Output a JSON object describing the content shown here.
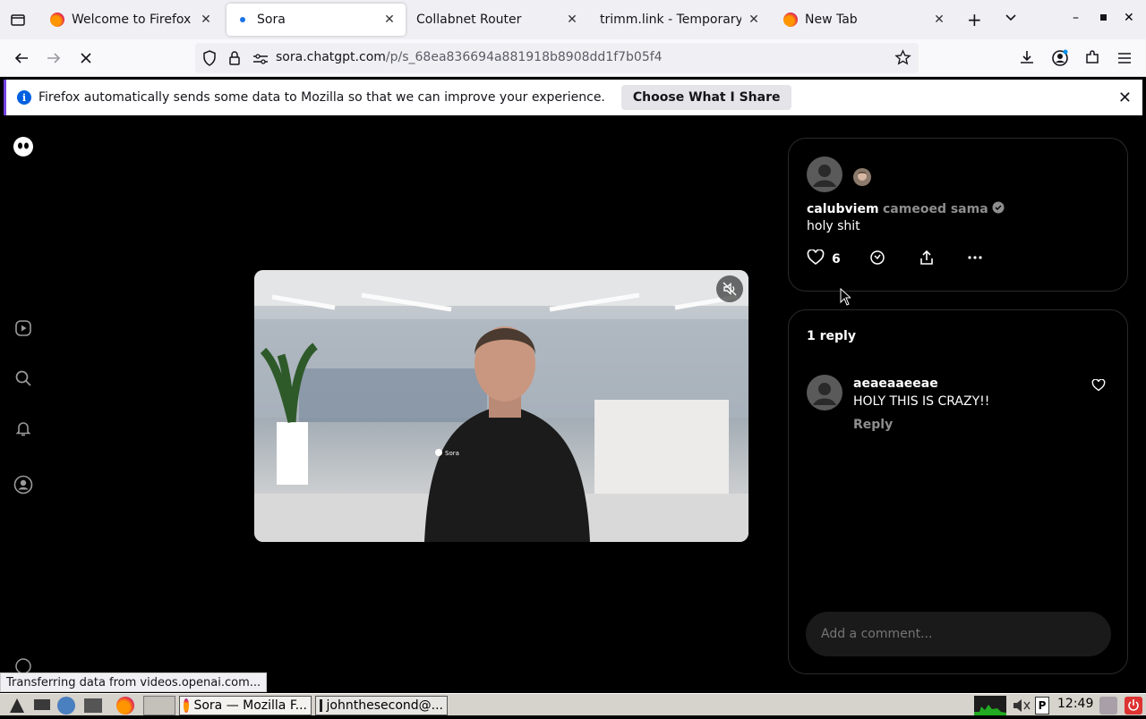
{
  "browser": {
    "tabs": [
      {
        "label": "Welcome to Firefox",
        "active": false
      },
      {
        "label": "Sora",
        "active": true
      },
      {
        "label": "Collabnet Router",
        "active": false
      },
      {
        "label": "trimm.link - Temporary U",
        "active": false
      },
      {
        "label": "New Tab",
        "active": false
      }
    ],
    "url_host": "sora.chatgpt.com",
    "url_path": "/p/s_68ea836694a881918b8908dd1f7b05f4",
    "url_prefix": "",
    "notification": {
      "message": "Firefox automatically sends some data to Mozilla so that we can improve your experience.",
      "button": "Choose What I Share"
    },
    "status": "Transferring data from videos.openai.com..."
  },
  "post": {
    "username": "calubviem",
    "action": "cameoed sama",
    "caption": "holy shit",
    "likes": "6"
  },
  "replies": {
    "header": "1 reply",
    "items": [
      {
        "username": "aeaeaaeeae",
        "text": "HOLY THIS IS CRAZY!!",
        "reply_label": "Reply"
      }
    ],
    "comment_placeholder": "Add a comment..."
  },
  "taskbar": {
    "windows": [
      "Sora — Mozilla F...",
      "johnthesecond@..."
    ],
    "clock": "12:49"
  },
  "colors": {
    "accent": "#7542e5",
    "info": "#0060df",
    "background": "#000000"
  }
}
